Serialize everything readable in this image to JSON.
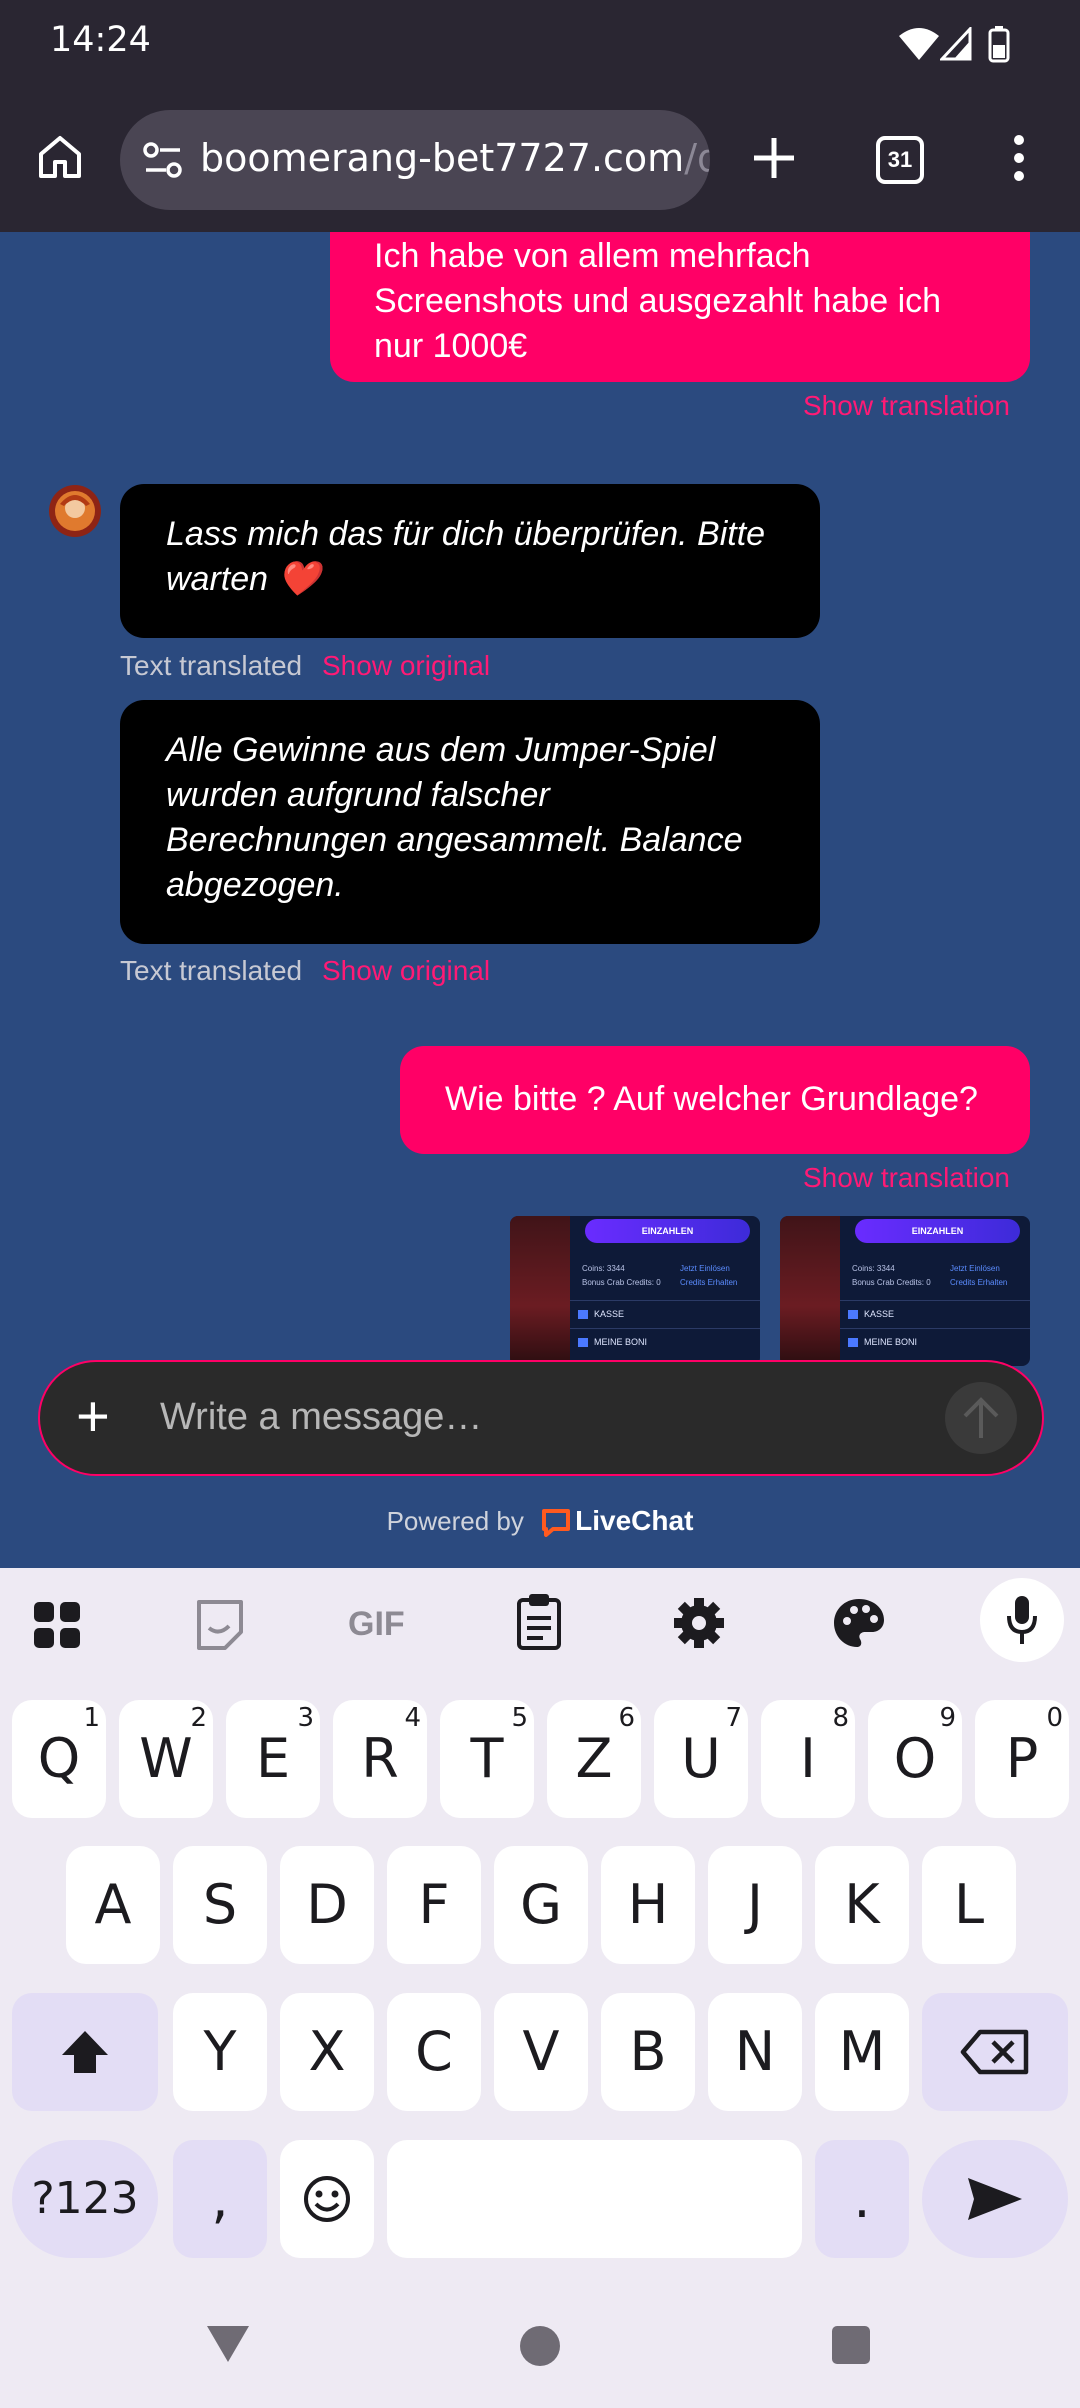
{
  "status_bar": {
    "time": "14:24"
  },
  "browser": {
    "url_host": "boomerang-bet7727.com",
    "url_path": "/d",
    "tab_count": "31"
  },
  "chat": {
    "msg1": {
      "lines": [
        "Ich habe von allem mehrfach",
        "Screenshots und ausgezahlt habe ich",
        "nur 1000€"
      ],
      "action": "Show translation"
    },
    "msg2": {
      "lines": [
        "Lass mich das für dich überprüfen. Bitte",
        "warten ❤️"
      ],
      "status": "Text translated",
      "action": "Show original"
    },
    "msg3": {
      "lines": [
        "Alle Gewinne aus dem Jumper-Spiel",
        "wurden aufgrund falscher",
        "Berechnungen angesammelt. Balance",
        "abgezogen."
      ],
      "status": "Text translated",
      "action": "Show original"
    },
    "msg4": {
      "text": "Wie bitte ? Auf welcher Grundlage?",
      "action": "Show translation"
    },
    "screenshot": {
      "button": "EINZAHLEN",
      "coins": "Coins: 3344",
      "coins_link": "Jetzt Einlösen",
      "bonus": "Bonus Crab Credits: 0",
      "bonus_link": "Credits Erhalten",
      "row1": "KASSE",
      "row2": "MEINE BONI"
    }
  },
  "composer": {
    "placeholder": "Write a message…"
  },
  "footer": {
    "powered_by": "Powered by",
    "brand": "LiveChat"
  },
  "keyboard": {
    "row1": [
      {
        "k": "Q",
        "n": "1"
      },
      {
        "k": "W",
        "n": "2"
      },
      {
        "k": "E",
        "n": "3"
      },
      {
        "k": "R",
        "n": "4"
      },
      {
        "k": "T",
        "n": "5"
      },
      {
        "k": "Z",
        "n": "6"
      },
      {
        "k": "U",
        "n": "7"
      },
      {
        "k": "I",
        "n": "8"
      },
      {
        "k": "O",
        "n": "9"
      },
      {
        "k": "P",
        "n": "0"
      }
    ],
    "row2": [
      "A",
      "S",
      "D",
      "F",
      "G",
      "H",
      "J",
      "K",
      "L"
    ],
    "row3": [
      "Y",
      "X",
      "C",
      "V",
      "B",
      "N",
      "M"
    ],
    "symbols": "?123",
    "comma": ",",
    "period": ".",
    "toolbar_gif": "GIF"
  },
  "colors": {
    "chat_bg": "#2b4a7f",
    "accent": "#ff0066",
    "bubble_in": "#000000",
    "keyboard_bg": "#eeeaf3"
  }
}
